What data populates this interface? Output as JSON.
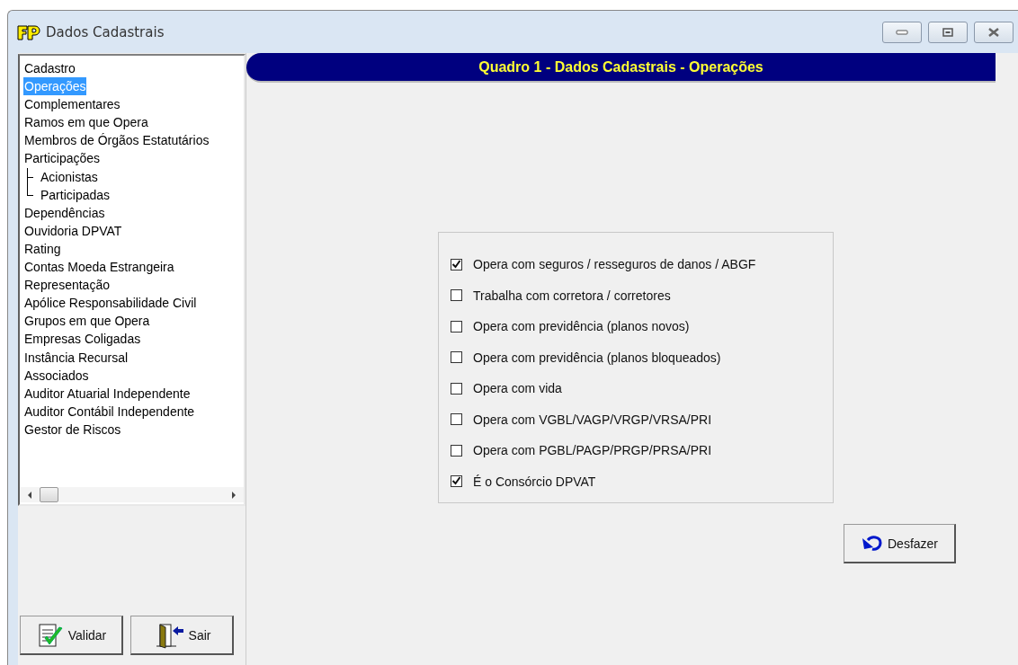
{
  "window": {
    "title": "Dados Cadastrais"
  },
  "sidebar": {
    "items": [
      {
        "label": "Cadastro",
        "selected": false
      },
      {
        "label": "Operações",
        "selected": true
      },
      {
        "label": "Complementares",
        "selected": false
      },
      {
        "label": "Ramos em que Opera",
        "selected": false
      },
      {
        "label": "Membros de Órgãos Estatutários",
        "selected": false
      },
      {
        "label": "Participações",
        "selected": false,
        "children": [
          {
            "label": "Acionistas",
            "selected": false
          },
          {
            "label": "Participadas",
            "selected": false
          }
        ]
      },
      {
        "label": "Dependências",
        "selected": false
      },
      {
        "label": "Ouvidoria DPVAT",
        "selected": false
      },
      {
        "label": "Rating",
        "selected": false
      },
      {
        "label": "Contas Moeda Estrangeira",
        "selected": false
      },
      {
        "label": "Representação",
        "selected": false
      },
      {
        "label": "Apólice Responsabilidade Civil",
        "selected": false
      },
      {
        "label": "Grupos em que Opera",
        "selected": false
      },
      {
        "label": "Empresas Coligadas",
        "selected": false
      },
      {
        "label": "Instância Recursal",
        "selected": false
      },
      {
        "label": "Associados",
        "selected": false
      },
      {
        "label": "Auditor Atuarial Independente",
        "selected": false
      },
      {
        "label": "Auditor Contábil Independente",
        "selected": false
      },
      {
        "label": "Gestor de Riscos",
        "selected": false
      }
    ]
  },
  "buttons": {
    "validate": "Validar",
    "exit": "Sair"
  },
  "panel": {
    "title": "Quadro 1 - Dados Cadastrais - Operações",
    "options": [
      {
        "label": "Opera com seguros / resseguros de danos / ABGF",
        "checked": true
      },
      {
        "label": "Trabalha com corretora / corretores",
        "checked": false
      },
      {
        "label": "Opera com previdência (planos novos)",
        "checked": false
      },
      {
        "label": "Opera com previdência (planos bloqueados)",
        "checked": false
      },
      {
        "label": "Opera com vida",
        "checked": false
      },
      {
        "label": "Opera com VGBL/VAGP/VRGP/VRSA/PRI",
        "checked": false
      },
      {
        "label": "Opera com PGBL/PAGP/PRGP/PRSA/PRI",
        "checked": false
      },
      {
        "label": "É o Consórcio DPVAT",
        "checked": true
      }
    ],
    "undo": "Desfazer"
  }
}
